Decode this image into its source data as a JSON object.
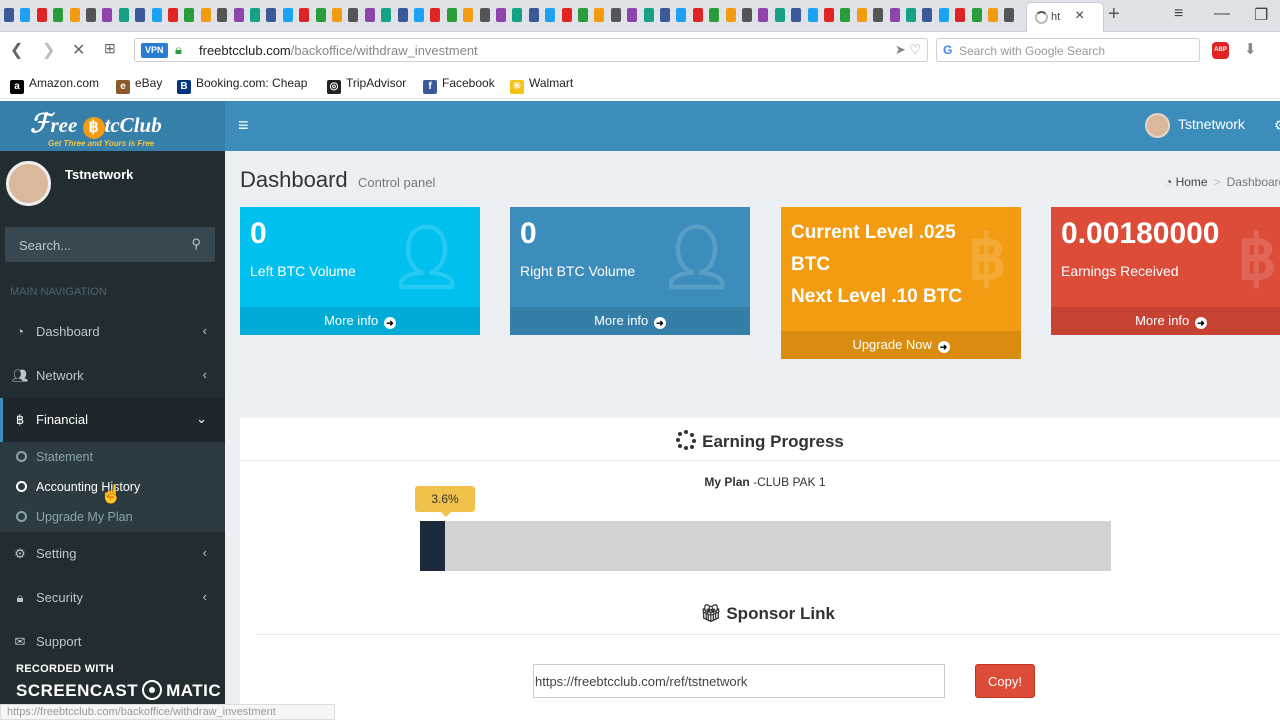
{
  "browser": {
    "active_tab_title": "ht",
    "vpn_badge": "VPN",
    "url_host": "freebtcclub.com",
    "url_path": "/backoffice/withdraw_investment",
    "search_placeholder": "Search with Google Search",
    "adblock_label": "ABP",
    "bookmarks": [
      {
        "label": "Amazon.com",
        "icon": "amazon-icon",
        "color": "#000000",
        "glyph": "a"
      },
      {
        "label": "eBay",
        "icon": "ebay-icon",
        "color": "#8b5a2b",
        "glyph": "e"
      },
      {
        "label": "Booking.com: Cheap",
        "icon": "booking-icon",
        "color": "#003580",
        "glyph": "B"
      },
      {
        "label": "TripAdvisor",
        "icon": "tripadvisor-icon",
        "color": "#222222",
        "glyph": "◎"
      },
      {
        "label": "Facebook",
        "icon": "facebook-icon",
        "color": "#3b5998",
        "glyph": "f"
      },
      {
        "label": "Walmart",
        "icon": "walmart-icon",
        "color": "#f2c318",
        "glyph": "✳"
      }
    ],
    "status_url": "https://freebtcclub.com/backoffice/withdraw_investment"
  },
  "app": {
    "logo_text_a": "ree ",
    "logo_text_b": "tcClub",
    "logo_tagline": "Get Three and Yours is Free",
    "user_name": "Tstnetwork",
    "colors": {
      "header": "#3c8dbc",
      "sidebar": "#222d32",
      "aqua": "#00c0ef",
      "blue": "#3c8dbc",
      "orange": "#f39c12",
      "red": "#dd4b39"
    }
  },
  "sidebar": {
    "user_name": "Tstnetwork",
    "search_placeholder": "Search...",
    "nav_header": "MAIN NAVIGATION",
    "items": [
      {
        "label": "Dashboard",
        "icon": "dashboard-icon"
      },
      {
        "label": "Network",
        "icon": "users-icon"
      },
      {
        "label": "Financial",
        "icon": "bitcoin-icon"
      },
      {
        "label": "Setting",
        "icon": "gear-icon"
      },
      {
        "label": "Security",
        "icon": "lock-icon"
      },
      {
        "label": "Support",
        "icon": "support-icon"
      }
    ],
    "financial_sub": [
      {
        "label": "Statement"
      },
      {
        "label": "Accounting History"
      },
      {
        "label": "Upgrade My Plan"
      }
    ]
  },
  "watermark": {
    "line1": "RECORDED WITH",
    "line2a": "SCREENCAST",
    "line2b": "MATIC"
  },
  "content": {
    "title": "Dashboard",
    "subtitle": "Control panel",
    "breadcrumb_home": "Home",
    "breadcrumb_current": "Dashboard",
    "boxes": [
      {
        "value": "0",
        "desc": "Left BTC Volume",
        "footer": "More info"
      },
      {
        "value": "0",
        "desc": "Right BTC Volume",
        "footer": "More info"
      },
      {
        "line1": "Current Level .025",
        "line2": "BTC",
        "line3": "Next Level .10 BTC",
        "footer": "Upgrade Now"
      },
      {
        "value": "0.00180000",
        "desc": "Earnings Received",
        "footer": "More info"
      }
    ],
    "earning_title": "Earning Progress",
    "plan_label": "My Plan",
    "plan_name": " -CLUB PAK 1",
    "progress_text": "3.6%",
    "progress_percent": 3.6,
    "sponsor_title": "Sponsor Link",
    "ref_link": "https://freebtcclub.com/ref/tstnetwork",
    "copy_label": "Copy!"
  }
}
